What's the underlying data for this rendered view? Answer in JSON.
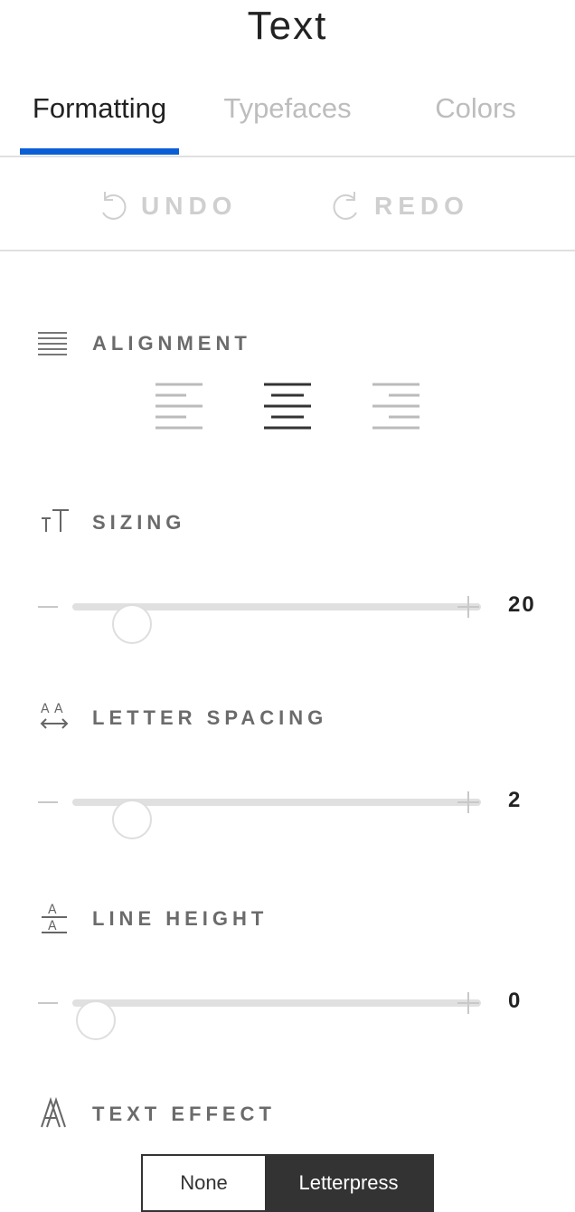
{
  "header": {
    "title": "Text"
  },
  "tabs": [
    {
      "label": "Formatting",
      "active": true
    },
    {
      "label": "Typefaces",
      "active": false
    },
    {
      "label": "Colors",
      "active": false
    }
  ],
  "history": {
    "undo_label": "UNDO",
    "redo_label": "REDO",
    "undo_icon": "undo-icon",
    "redo_icon": "redo-icon"
  },
  "alignment": {
    "label": "ALIGNMENT",
    "icon": "alignment-icon",
    "options": [
      "left",
      "center",
      "right"
    ],
    "selected": "center"
  },
  "sizing": {
    "label": "SIZING",
    "icon": "text-size-icon",
    "value": "20",
    "min": 0,
    "max": 100,
    "level": 0.16
  },
  "letter_spacing": {
    "label": "LETTER SPACING",
    "icon": "letter-spacing-icon",
    "value": "2",
    "level": 0.16
  },
  "line_height": {
    "label": "LINE HEIGHT",
    "icon": "line-height-icon",
    "value": "0",
    "level": 0.06
  },
  "text_effect": {
    "label": "TEXT EFFECT",
    "icon": "text-effect-icon",
    "options": [
      "None",
      "Letterpress"
    ],
    "selected": "Letterpress"
  },
  "colors": {
    "accent": "#0b5fd6",
    "dark": "#333333",
    "muted": "#bdbdbd"
  }
}
